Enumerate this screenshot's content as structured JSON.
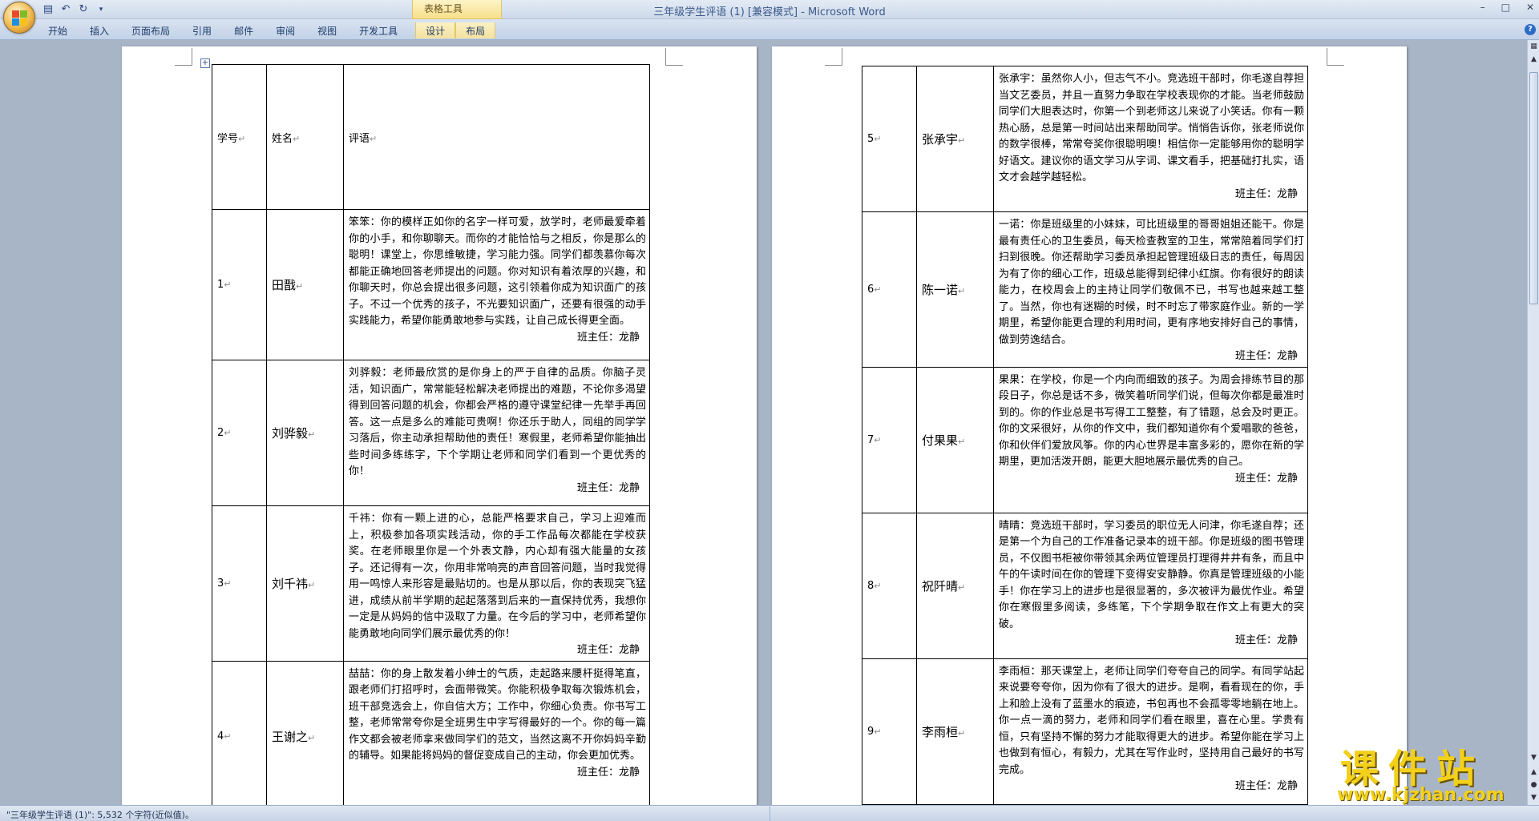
{
  "window": {
    "title": "三年级学生评语 (1) [兼容模式] - ",
    "app_name": "Microsoft Word",
    "context_tab_group": "表格工具",
    "controls": [
      "–",
      "□",
      "✕"
    ]
  },
  "ribbon": {
    "tabs": [
      "开始",
      "插入",
      "页面布局",
      "引用",
      "邮件",
      "审阅",
      "视图",
      "开发工具",
      "设计",
      "布局"
    ]
  },
  "table_header": {
    "col_no": "学号",
    "col_name": "姓名",
    "col_comment": "评语"
  },
  "left_rows": [
    {
      "no": "1",
      "name": "田戬",
      "comment": "笨笨：你的模样正如你的名字一样可爱，放学时，老师最爱牵着你的小手，和你聊聊天。而你的才能恰恰与之相反，你是那么的聪明！课堂上，你思维敏捷，学习能力强。同学们都羡慕你每次都能正确地回答老师提出的问题。你对知识有着浓厚的兴趣，和你聊天时，你总会提出很多问题，这引领着你成为知识面广的孩子。不过一个优秀的孩子，不光要知识面广，还要有很强的动手实践能力，希望你能勇敢地参与实践，让自己成长得更全面。",
      "signature": "班主任：龙静"
    },
    {
      "no": "2",
      "name": "刘骅毅",
      "comment": "刘骅毅：老师最欣赏的是你身上的严于自律的品质。你脑子灵活，知识面广，常常能轻松解决老师提出的难题，不论你多渴望得到回答问题的机会，你都会严格的遵守课堂纪律一先举手再回答。这一点是多么的难能可贵啊！你还乐于助人，同组的同学学习落后，你主动承担帮助他的责任！寒假里，老师希望你能抽出些时间多练练字，下个学期让老师和同学们看到一个更优秀的你！",
      "signature": "班主任：龙静"
    },
    {
      "no": "3",
      "name": "刘千祎",
      "comment": "千祎：你有一颗上进的心，总能严格要求自己，学习上迎难而上，积极参加各项实践活动，你的手工作品每次都能在学校获奖。在老师眼里你是一个外表文静，内心却有强大能量的女孩子。还记得有一次，你用非常响亮的声音回答问题，当时我觉得用一鸣惊人来形容是最贴切的。也是从那以后，你的表现突飞猛进，成绩从前半学期的起起落落到后来的一直保持优秀，我想你一定是从妈妈的信中汲取了力量。在今后的学习中，老师希望你能勇敢地向同学们展示最优秀的你！",
      "signature": "班主任：龙静"
    },
    {
      "no": "4",
      "name": "王谢之",
      "comment": "喆喆：你的身上散发着小绅士的气质，走起路来腰杆挺得笔直，跟老师们打招呼时，会面带微笑。你能积极争取每次锻炼机会，班干部竞选会上，你自信大方；工作中，你细心负责。你书写工整，老师常常夸你是全班男生中字写得最好的一个。你的每一篇作文都会被老师拿来做同学们的范文，当然这离不开你妈妈辛勤的辅导。如果能将妈妈的督促变成自己的主动，你会更加优秀。",
      "signature": "班主任：龙静"
    }
  ],
  "right_rows": [
    {
      "no": "5",
      "name": "张承宇",
      "comment": "张承宇：虽然你人小，但志气不小。竞选班干部时，你毛遂自荐担当文艺委员，并且一直努力争取在学校表现你的才能。当老师鼓励同学们大胆表达时，你第一个到老师这儿来说了小笑话。你有一颗热心肠，总是第一时间站出来帮助同学。悄悄告诉你，张老师说你的数学很棒，常常夸奖你很聪明噢！相信你一定能够用你的聪明学好语文。建议你的语文学习从字词、课文看手，把基础打扎实，语文才会越学越轻松。",
      "signature": "班主任：龙静"
    },
    {
      "no": "6",
      "name": "陈一诺",
      "comment": "一诺：你是班级里的小妹妹，可比班级里的哥哥姐姐还能干。你是最有责任心的卫生委员，每天检查教室的卫生，常常陪着同学们打扫到很晚。你还帮助学习委员承担起管理班级日志的责任，每周因为有了你的细心工作，班级总能得到纪律小红旗。你有很好的朗读能力，在校周会上的主持让同学们敬佩不已，书写也越来越工整了。当然，你也有迷糊的时候，时不时忘了带家庭作业。新的一学期里，希望你能更合理的利用时间，更有序地安排好自己的事情，做到劳逸结合。",
      "signature": "班主任：龙静"
    },
    {
      "no": "7",
      "name": "付果果",
      "comment": "果果：在学校，你是一个内向而细致的孩子。为周会排练节目的那段日子，你总是话不多，微笑着听同学们说，但每次你都是最准时到的。你的作业总是书写得工工整整，有了错题，总会及时更正。你的文采很好，从你的作文中，我们都知道你有个爱唱歌的爸爸，你和伙伴们爱放风筝。你的内心世界是丰富多彩的，愿你在新的学期里，更加活泼开朗，能更大胆地展示最优秀的自己。",
      "signature": "班主任：龙静"
    },
    {
      "no": "8",
      "name": "祝阡晴",
      "comment": "晴晴：竞选班干部时，学习委员的职位无人问津，你毛遂自荐；还是第一个为自己的工作准备记录本的班干部。你是班级的图书管理员，不仅图书柜被你带领其余两位管理员打理得井井有条，而且中午的午读时间在你的管理下变得安安静静。你真是管理班级的小能手！你在学习上的进步也是很显著的，多次被评为最优作业。希望你在寒假里多阅读，多练笔，下个学期争取在作文上有更大的突破。",
      "signature": "班主任：龙静"
    },
    {
      "no": "9",
      "name": "李雨桓",
      "comment": "李雨桓：那天课堂上，老师让同学们夸夸自己的同学。有同学站起来说要夸夸你，因为你有了很大的进步。是啊，看看现在的你，手上和脸上没有了蓝墨水的痕迹，书包再也不会孤零零地躺在地上。你一点一滴的努力，老师和同学们看在眼里，喜在心里。学贵有恒，只有坚持不懈的努力才能取得更大的进步。希望你能在学习上也做到有恒心，有毅力，尤其在写作业时，坚持用自己最好的书写完成。",
      "signature": "班主任：龙静"
    }
  ],
  "statusbar": {
    "text": "\"三年级学生评语 (1)\": 5,532 个字符(近似值)。"
  },
  "watermark": {
    "title": "课件站",
    "url": "www.kjzhan.com"
  }
}
